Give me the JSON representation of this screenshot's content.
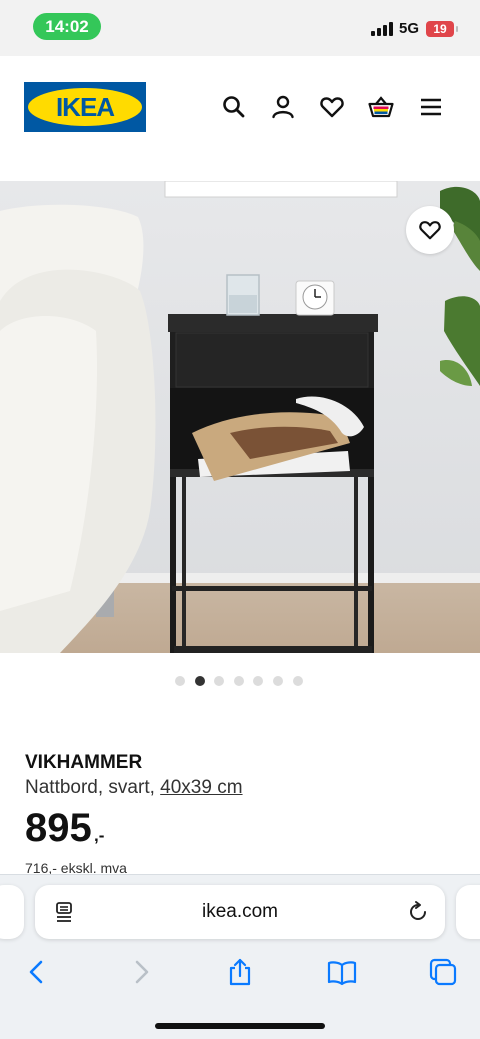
{
  "status_bar": {
    "time": "14:02",
    "network": "5G",
    "battery": "19"
  },
  "header": {
    "logo_text": "IKEA",
    "icons": [
      "search-icon",
      "user-icon",
      "heart-icon",
      "basket-icon",
      "menu-icon"
    ]
  },
  "gallery": {
    "image_count": 7,
    "active_index": 1
  },
  "product": {
    "name": "VIKHAMMER",
    "description": "Nattbord, svart, ",
    "size_link": "40x39 cm",
    "price": "895",
    "price_suffix": ",-",
    "price_ex_vat": "716,- ekskl. mva"
  },
  "browser": {
    "url": "ikea.com"
  },
  "colors": {
    "brand_blue": "#0058a3",
    "brand_yellow": "#ffdb00",
    "time_pill": "#34c759",
    "accent_blue": "#0a7aff"
  }
}
